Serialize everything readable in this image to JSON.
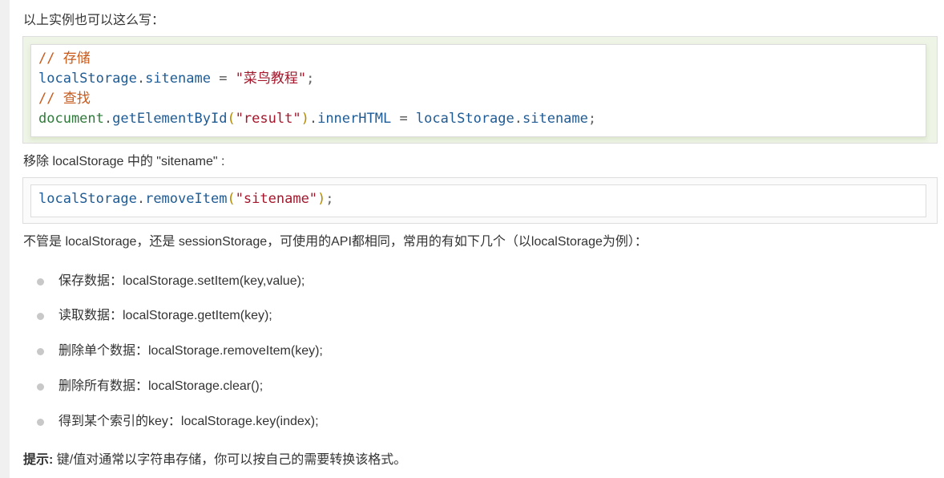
{
  "intro_text": "以上实例也可以这么写：",
  "code_block_1": {
    "line1": {
      "comment": "// 存储"
    },
    "line2": {
      "obj": "localStorage",
      "dot": ".",
      "prop": "sitename",
      "op": " = ",
      "str": "\"菜鸟教程\"",
      "semi": ";"
    },
    "line3": {
      "comment": "// 查找"
    },
    "line4": {
      "obj": "document",
      "dot1": ".",
      "method": "getElementById",
      "open": "(",
      "str": "\"result\"",
      "close": ")",
      "dot2": ".",
      "prop": "innerHTML",
      "op": " = ",
      "obj2": "localStorage",
      "dot3": ".",
      "prop2": "sitename",
      "semi": ";"
    }
  },
  "remove_text": "移除 localStorage 中的 \"sitename\" :",
  "code_block_2": {
    "obj": "localStorage",
    "dot": ".",
    "method": "removeItem",
    "open": "(",
    "str": "\"sitename\"",
    "close": ")",
    "semi": ";"
  },
  "summary_text": "不管是 localStorage，还是 sessionStorage，可使用的API都相同，常用的有如下几个（以localStorage为例）：",
  "api_list": [
    "保存数据：localStorage.setItem(key,value);",
    "读取数据：localStorage.getItem(key);",
    "删除单个数据：localStorage.removeItem(key);",
    "删除所有数据：localStorage.clear();",
    "得到某个索引的key：localStorage.key(index);"
  ],
  "tip": {
    "label": "提示:",
    "text": " 键/值对通常以字符串存储，你可以按自己的需要转换该格式。"
  }
}
